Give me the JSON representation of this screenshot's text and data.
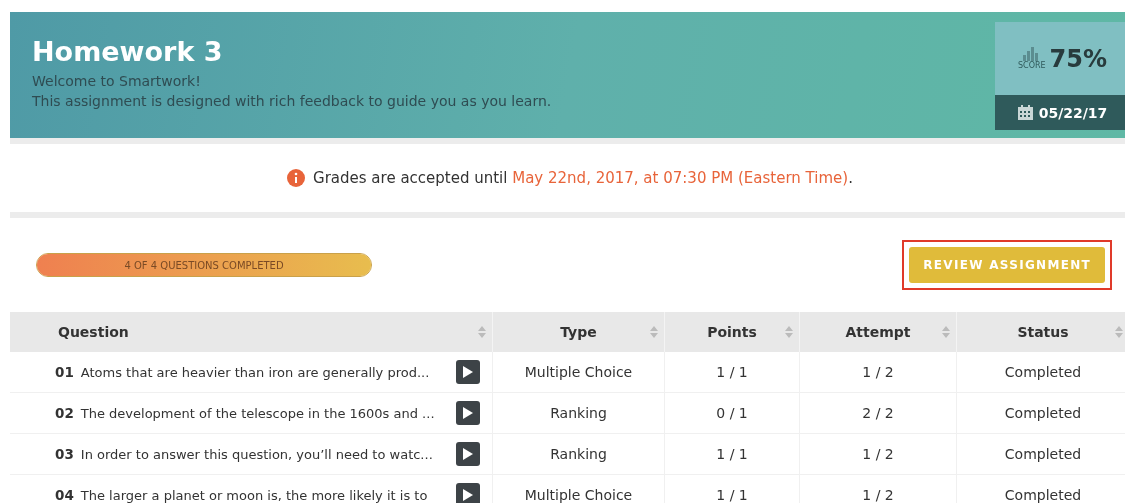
{
  "header": {
    "title": "Homework 3",
    "subtitle": "Welcome to Smartwork!",
    "description": "This assignment is designed with rich feedback to guide you as you learn.",
    "score_label": "SCORE",
    "score": "75%",
    "due_date": "05/22/17"
  },
  "notice": {
    "text": "Grades are accepted until ",
    "deadline": "May 22nd, 2017, at 07:30 PM (Eastern Time)",
    "end": "."
  },
  "progress": {
    "label": "4 OF 4 QUESTIONS COMPLETED",
    "level": 1
  },
  "review_button": {
    "label": "REVIEW ASSIGNMENT",
    "highlighted": true
  },
  "table": {
    "columns": [
      "Question",
      "Type",
      "Points",
      "Attempt",
      "Status"
    ],
    "rows": [
      {
        "number": "01",
        "question": "Atoms that are heavier than iron are generally prod...",
        "type": "Multiple Choice",
        "points": "1 / 1",
        "attempt": "1 / 2",
        "status": "Completed"
      },
      {
        "number": "02",
        "question": "The development of the telescope in the 1600s and ...",
        "type": "Ranking",
        "points": "0 / 1",
        "attempt": "2 / 2",
        "status": "Completed"
      },
      {
        "number": "03",
        "question": "In order to answer this question, you’ll need to watc...",
        "type": "Ranking",
        "points": "1 / 1",
        "attempt": "1 / 2",
        "status": "Completed"
      },
      {
        "number": "04",
        "question": "The larger a planet or moon is, the more likely it is to",
        "type": "Multiple Choice",
        "points": "1 / 1",
        "attempt": "1 / 2",
        "status": "Completed"
      }
    ]
  }
}
